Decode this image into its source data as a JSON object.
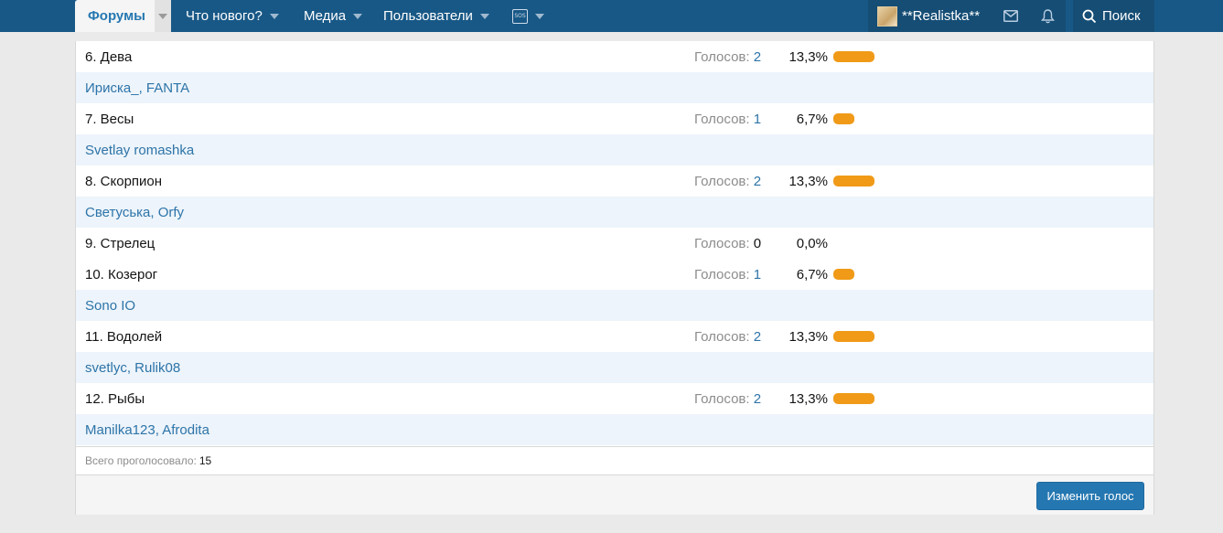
{
  "nav": {
    "active_tab": "Форумы",
    "items": [
      {
        "label": "Что нового?"
      },
      {
        "label": "Медиа"
      },
      {
        "label": "Пользователи"
      }
    ],
    "sos_label": "SOS",
    "username": "**Realistka**",
    "search_label": "Поиск"
  },
  "poll": {
    "votes_prefix": "Голосов:",
    "rows": [
      {
        "type": "option",
        "label": "6. Дева",
        "votes": "2",
        "percent": "13,3%",
        "fraction": 0.133
      },
      {
        "type": "voters",
        "label": "Ириска_, FANTA"
      },
      {
        "type": "option",
        "label": "7. Весы",
        "votes": "1",
        "percent": "6,7%",
        "fraction": 0.067
      },
      {
        "type": "voters",
        "label": "Svetlay romashka"
      },
      {
        "type": "option",
        "label": "8. Скорпион",
        "votes": "2",
        "percent": "13,3%",
        "fraction": 0.133
      },
      {
        "type": "voters",
        "label": "Светуська, Orfy"
      },
      {
        "type": "option",
        "label": "9. Стрелец",
        "votes": "0",
        "percent": "0,0%",
        "fraction": 0
      },
      {
        "type": "option",
        "label": "10. Козерог",
        "votes": "1",
        "percent": "6,7%",
        "fraction": 0.067
      },
      {
        "type": "voters",
        "label": "Sono IO"
      },
      {
        "type": "option",
        "label": "11. Водолей",
        "votes": "2",
        "percent": "13,3%",
        "fraction": 0.133
      },
      {
        "type": "voters",
        "label": "svetlyc, Rulik08"
      },
      {
        "type": "option",
        "label": "12. Рыбы",
        "votes": "2",
        "percent": "13,3%",
        "fraction": 0.133
      },
      {
        "type": "voters",
        "label": "Manilka123, Afrodita"
      }
    ],
    "total_label": "Всего проголосовало:",
    "total_value": "15",
    "change_vote_label": "Изменить голос"
  },
  "colors": {
    "nav_bg": "#185886",
    "accent": "#2577b1",
    "bar": "#f09a18",
    "row_alt": "#edf4fb"
  }
}
